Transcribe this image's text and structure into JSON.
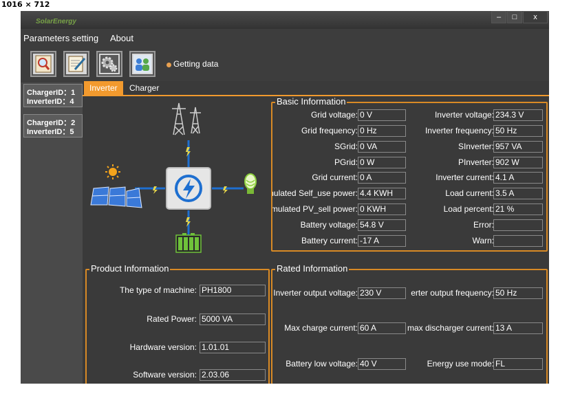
{
  "dimension_label": "1016 × 712",
  "window": {
    "logo_text": "SolarEnergy",
    "min": "–",
    "max": "□",
    "close": "x"
  },
  "menu": {
    "parameters": "Parameters setting",
    "about": "About"
  },
  "toolbar": {
    "status_text": "Getting data",
    "status_color": "#e8a050"
  },
  "devices": [
    {
      "charger": "ChargerID：1",
      "inverter": "InverterID：4"
    },
    {
      "charger": "ChargerID：2",
      "inverter": "InverterID：5"
    }
  ],
  "tabs": {
    "inverter": "Inverter",
    "charger": "Charger"
  },
  "basic": {
    "title": "Basic Information",
    "left": [
      {
        "label": "Grid voltage:",
        "value": "0 V"
      },
      {
        "label": "Grid frequency:",
        "value": "0 Hz"
      },
      {
        "label": "SGrid:",
        "value": "0 VA"
      },
      {
        "label": "PGrid:",
        "value": "0 W"
      },
      {
        "label": "Grid current:",
        "value": "0 A"
      },
      {
        "label": "nulated Self_use power:",
        "value": "4.4 KWH"
      },
      {
        "label": "mulated PV_sell power:",
        "value": "0 KWH"
      },
      {
        "label": "Battery voltage:",
        "value": "54.8 V"
      },
      {
        "label": "Battery current:",
        "value": "-17 A"
      }
    ],
    "right": [
      {
        "label": "Inverter voltage:",
        "value": "234.3 V"
      },
      {
        "label": "Inverter frequency:",
        "value": "50 Hz"
      },
      {
        "label": "SInverter:",
        "value": "957 VA"
      },
      {
        "label": "PInverter:",
        "value": "902 W"
      },
      {
        "label": "Inverter current:",
        "value": "4.1 A"
      },
      {
        "label": "Load current:",
        "value": "3.5 A"
      },
      {
        "label": "Load percent:",
        "value": "21 %"
      },
      {
        "label": "Error:",
        "value": ""
      },
      {
        "label": "Warn:",
        "value": ""
      }
    ]
  },
  "product": {
    "title": "Product Information",
    "fields": [
      {
        "label": "The type of machine:",
        "value": "PH1800"
      },
      {
        "label": "Rated Power:",
        "value": "5000 VA"
      },
      {
        "label": "Hardware version:",
        "value": "1.01.01"
      },
      {
        "label": "Software version:",
        "value": "2.03.06"
      }
    ]
  },
  "rated": {
    "title": "Rated Information",
    "left": [
      {
        "label": "Inverter output voltage:",
        "value": "230 V"
      },
      {
        "label": "Max charge current:",
        "value": "60 A"
      },
      {
        "label": "Battery low voltage:",
        "value": "40 V"
      }
    ],
    "right": [
      {
        "label": "erter output frequency:",
        "value": "50 Hz"
      },
      {
        "label": "max discharger current:",
        "value": "13 A"
      },
      {
        "label": "Energy use mode:",
        "value": "FL"
      }
    ]
  },
  "colors": {
    "accent": "#f29a2e",
    "background": "#3d3d3d",
    "flow_line": "#1e6fd0",
    "battery": "#6fc23a"
  },
  "icons": [
    "search-icon",
    "notepad-icon",
    "settings-gear-icon",
    "users-icon",
    "transmission-tower-icon",
    "sun-icon",
    "solar-panel-icon",
    "inverter-lightning-icon",
    "light-bulb-icon",
    "battery-icon"
  ]
}
